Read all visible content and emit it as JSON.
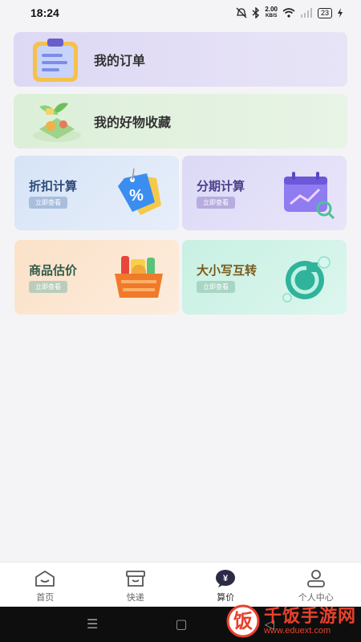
{
  "status": {
    "time": "18:24",
    "net_speed": "2.00",
    "net_unit": "KB/S",
    "battery": "23"
  },
  "menu": {
    "orders_label": "我的订单",
    "favorites_label": "我的好物收藏"
  },
  "tools": [
    {
      "title": "折扣计算",
      "button": "立即查看"
    },
    {
      "title": "分期计算",
      "button": "立即查看"
    },
    {
      "title": "商品估价",
      "button": "立即查看"
    },
    {
      "title": "大小写互转",
      "button": "立即查看"
    }
  ],
  "nav": {
    "items": [
      {
        "label": "首页",
        "icon": "home-icon"
      },
      {
        "label": "快递",
        "icon": "package-icon"
      },
      {
        "label": "算价",
        "icon": "yuan-icon"
      },
      {
        "label": "个人中心",
        "icon": "person-icon"
      }
    ],
    "active_index": 2
  },
  "system_nav": {
    "menu_glyph": "☰",
    "home_glyph": "▢",
    "back_glyph": "◁"
  },
  "watermark": {
    "title": "千饭手游网",
    "url": "www.eduext.com",
    "logo_char": "饭"
  },
  "colors": {
    "watermark_red": "#e8412c",
    "accent_purple": "#7b6cd9"
  }
}
